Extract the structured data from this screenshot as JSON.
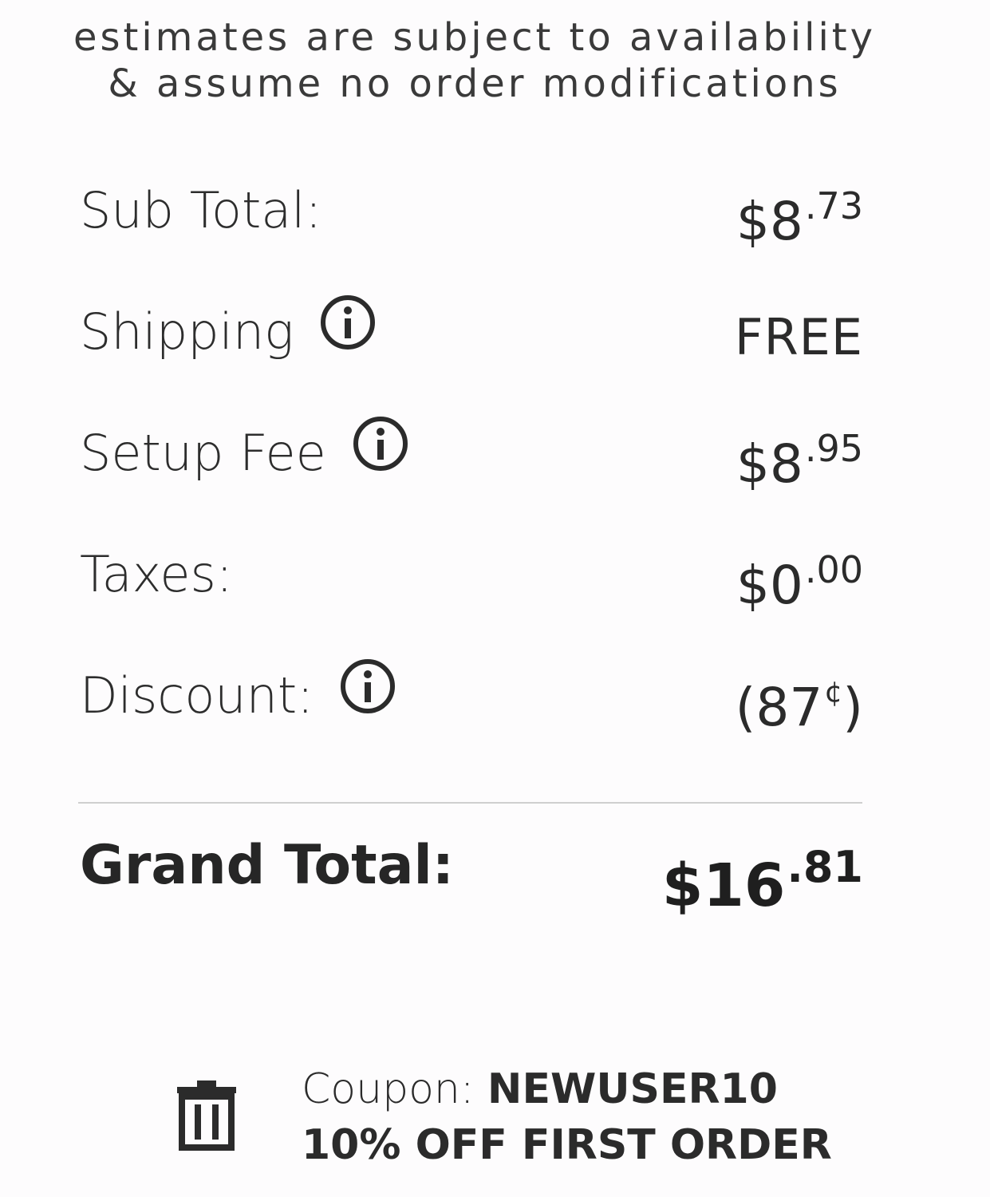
{
  "disclaimer": {
    "line1": "estimates are subject to availability",
    "line2": "& assume no order modifications"
  },
  "summary": [
    {
      "label": "Sub Total:",
      "has_info": false,
      "value_main": "$8",
      "value_sup": ".73"
    },
    {
      "label": "Shipping",
      "has_info": true,
      "value_text": "FREE"
    },
    {
      "label": "Setup Fee",
      "has_info": true,
      "value_main": "$8",
      "value_sup": ".95"
    },
    {
      "label": "Taxes:",
      "has_info": false,
      "value_main": "$0",
      "value_sup": ".00"
    },
    {
      "label": "Discount:",
      "has_info": true,
      "value_main": "(87",
      "value_sup": "¢",
      "value_suffix": ")"
    }
  ],
  "grand_total": {
    "label": "Grand Total:",
    "value_main": "$16",
    "value_sup": ".81"
  },
  "coupon": {
    "prefix": "Coupon: ",
    "code": "NEWUSER10",
    "description": "10% OFF FIRST ORDER",
    "remove_icon": "trash-icon"
  },
  "icons": {
    "info": "info-icon",
    "remove": "trash-icon"
  },
  "colors": {
    "text": "#2b2b2b",
    "divider": "#cfcfcf",
    "background": "#fdfcfd"
  }
}
